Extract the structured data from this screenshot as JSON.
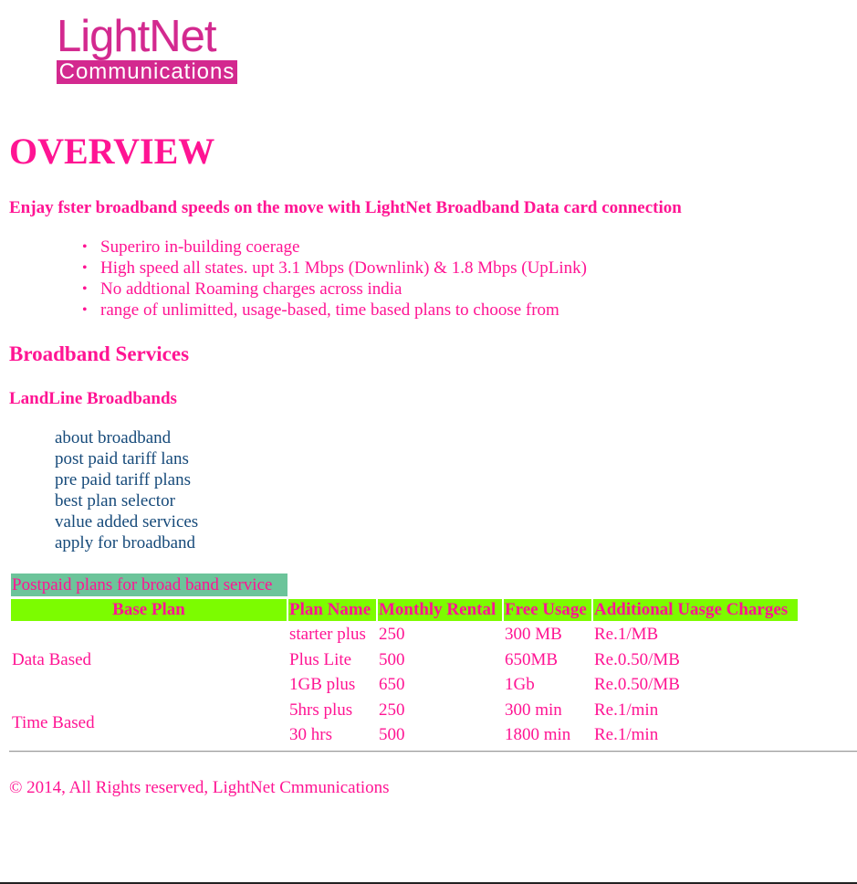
{
  "logo": {
    "top": "LightNet",
    "bottom": "Communications"
  },
  "overview": {
    "title": "OVERVIEW",
    "tagline": "Enjay fster broadband speeds on the move with LightNet Broadband Data card connection",
    "features": [
      "Superiro in-building coerage",
      "High speed all states. upt 3.1 Mbps (Downlink) & 1.8 Mbps (UpLink)",
      "No addtional Roaming charges across india",
      "range of unlimitted, usage-based, time based plans to choose from"
    ],
    "bullet": "•"
  },
  "broadband": {
    "heading": "Broadband Services",
    "subheading": "LandLine Broadbands",
    "links": [
      "about broadband",
      "post paid tariff lans",
      "pre paid tariff plans",
      "best plan selector",
      "value added services",
      "apply for broadband"
    ]
  },
  "plans": {
    "caption": "Postpaid plans for broad band service",
    "headers": [
      "Base Plan",
      "Plan Name",
      "Monthly Rental",
      "Free Usage",
      "Additional Uasge Charges"
    ],
    "groups": [
      {
        "base": "Data Based",
        "rows": [
          [
            "starter plus",
            "250",
            "300 MB",
            "Re.1/MB"
          ],
          [
            "Plus Lite",
            "500",
            "650MB",
            "Re.0.50/MB"
          ],
          [
            "1GB plus",
            "650",
            "1Gb",
            "Re.0.50/MB"
          ]
        ]
      },
      {
        "base": "Time Based",
        "rows": [
          [
            "5hrs plus",
            "250",
            "300 min",
            "Re.1/min"
          ],
          [
            "30 hrs",
            "500",
            "1800 min",
            "Re.1/min"
          ]
        ]
      }
    ]
  },
  "footer": {
    "text": "© 2014, All Rights reserved, LightNet Cmmunications"
  },
  "colors": {
    "accent": "#ff1493",
    "logo": "#d3298f",
    "link": "#164a7a",
    "header_bg": "#7cfc00",
    "caption_bg": "#6cc49a"
  }
}
